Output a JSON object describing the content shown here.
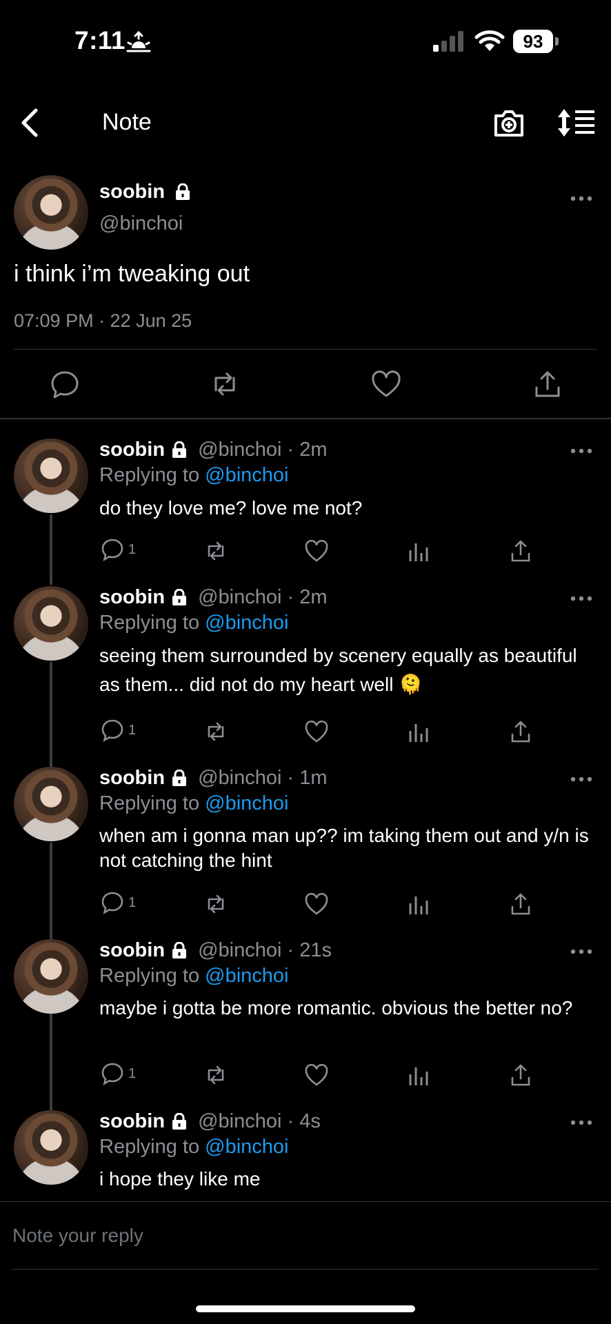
{
  "status_bar": {
    "time": "7:11",
    "battery": "93"
  },
  "header": {
    "title": "Note"
  },
  "post": {
    "name": "soobin",
    "handle": "@binchoi",
    "text": "i think i’m tweaking out",
    "meta": "07:09 PM · 22 Jun 25"
  },
  "replies": [
    {
      "name": "soobin",
      "handle_time": "@binchoi · 2m",
      "replying_prefix": "Replying to ",
      "mention": "@binchoi",
      "text": "do they love me? love me not?",
      "reply_count": "1"
    },
    {
      "name": "soobin",
      "handle_time": "@binchoi · 2m",
      "replying_prefix": "Replying to ",
      "mention": "@binchoi",
      "text": "seeing them surrounded by scenery equally as beautiful as them... did not do my heart well 🫠",
      "reply_count": "1"
    },
    {
      "name": "soobin",
      "handle_time": "@binchoi · 1m",
      "replying_prefix": "Replying to ",
      "mention": "@binchoi",
      "text": "when am i gonna man up?? im taking them out and y/n is not catching the hint",
      "reply_count": "1"
    },
    {
      "name": "soobin",
      "handle_time": "@binchoi · 21s",
      "replying_prefix": "Replying to ",
      "mention": "@binchoi",
      "text": "maybe i gotta be more romantic. obvious the better no?",
      "reply_count": "1"
    },
    {
      "name": "soobin",
      "handle_time": "@binchoi · 4s",
      "replying_prefix": "Replying to ",
      "mention": "@binchoi",
      "text": "i hope they like me"
    }
  ],
  "composer": {
    "placeholder": "Note your reply"
  },
  "colors": {
    "accent": "#1d9bf0",
    "muted": "#8b8f94",
    "background": "#000000"
  }
}
